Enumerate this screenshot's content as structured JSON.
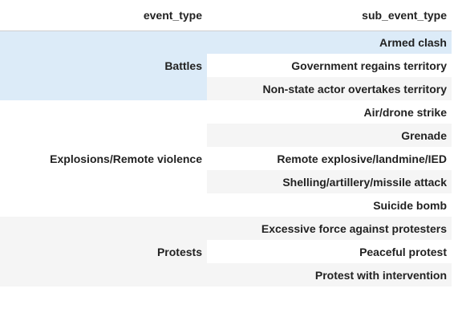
{
  "table": {
    "headers": [
      "event_type",
      "sub_event_type"
    ],
    "groups": [
      {
        "event_type": "Battles",
        "sub_event_types": [
          "Armed clash",
          "Government regains territory",
          "Non-state actor overtakes territory"
        ]
      },
      {
        "event_type": "Explosions/Remote violence",
        "sub_event_types": [
          "Air/drone strike",
          "Grenade",
          "Remote explosive/landmine/IED",
          "Shelling/artillery/missile attack",
          "Suicide bomb"
        ]
      },
      {
        "event_type": "Protests",
        "sub_event_types": [
          "Excessive force against protesters",
          "Peaceful protest",
          "Protest with intervention"
        ]
      }
    ]
  },
  "colors": {
    "highlight": "#dcebf8",
    "stripe": "#f5f5f5",
    "text": "#222222"
  }
}
